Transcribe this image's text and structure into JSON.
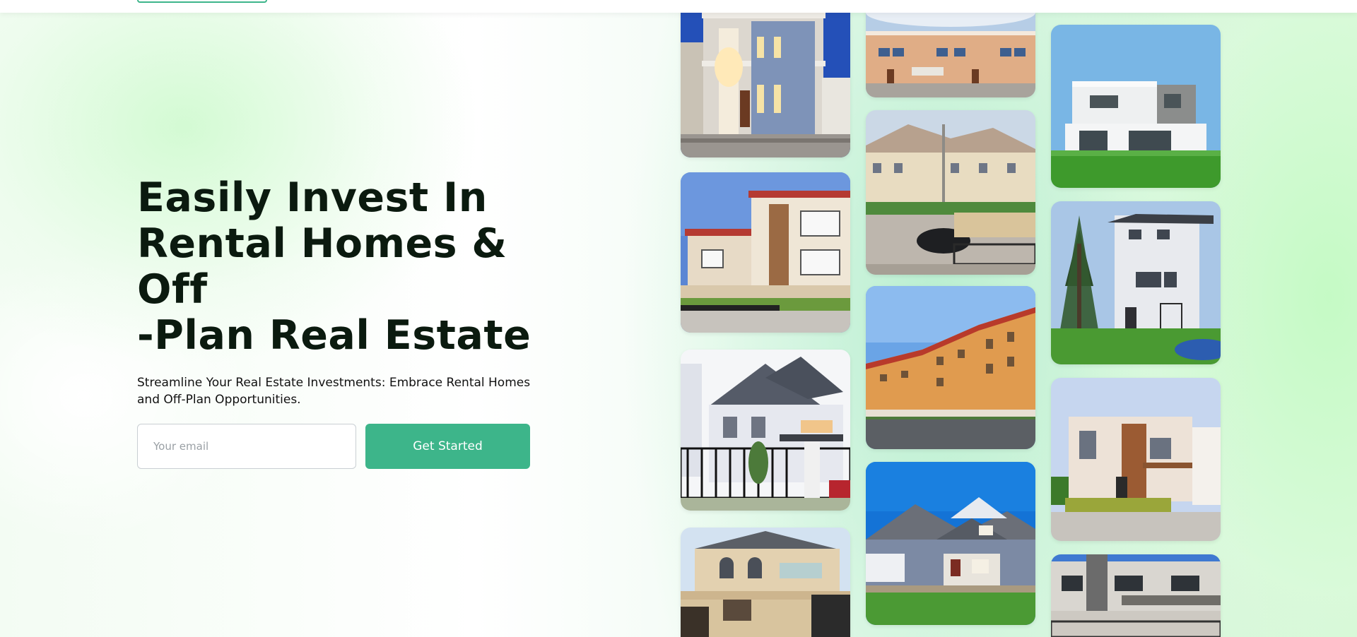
{
  "hero": {
    "title_line1": "Easily Invest In",
    "title_line2": "Rental Homes & Off",
    "title_line3": "-Plan Real Estate",
    "subtitle": "Streamline Your Real Estate Investments: Embrace Rental Homes and Off-Plan Opportunities.",
    "email_placeholder": "Your email",
    "cta_label": "Get Started"
  },
  "colors": {
    "accent": "#3db58a",
    "title": "#0b1a0f"
  },
  "gallery": {
    "columns": [
      [
        "two-story-villa-lit-night",
        "cream-duplex-estate",
        "white-gray-roof-mansion",
        "beige-house-gate"
      ],
      [
        "orange-terrace-townhouses",
        "row-houses-parked-car",
        "orange-apartment-blocks",
        "blue-suburban-house"
      ],
      [
        "modern-white-villa-lawn",
        "white-modern-house-pine",
        "cream-modern-house-wood",
        "gray-modern-duplex"
      ]
    ]
  }
}
